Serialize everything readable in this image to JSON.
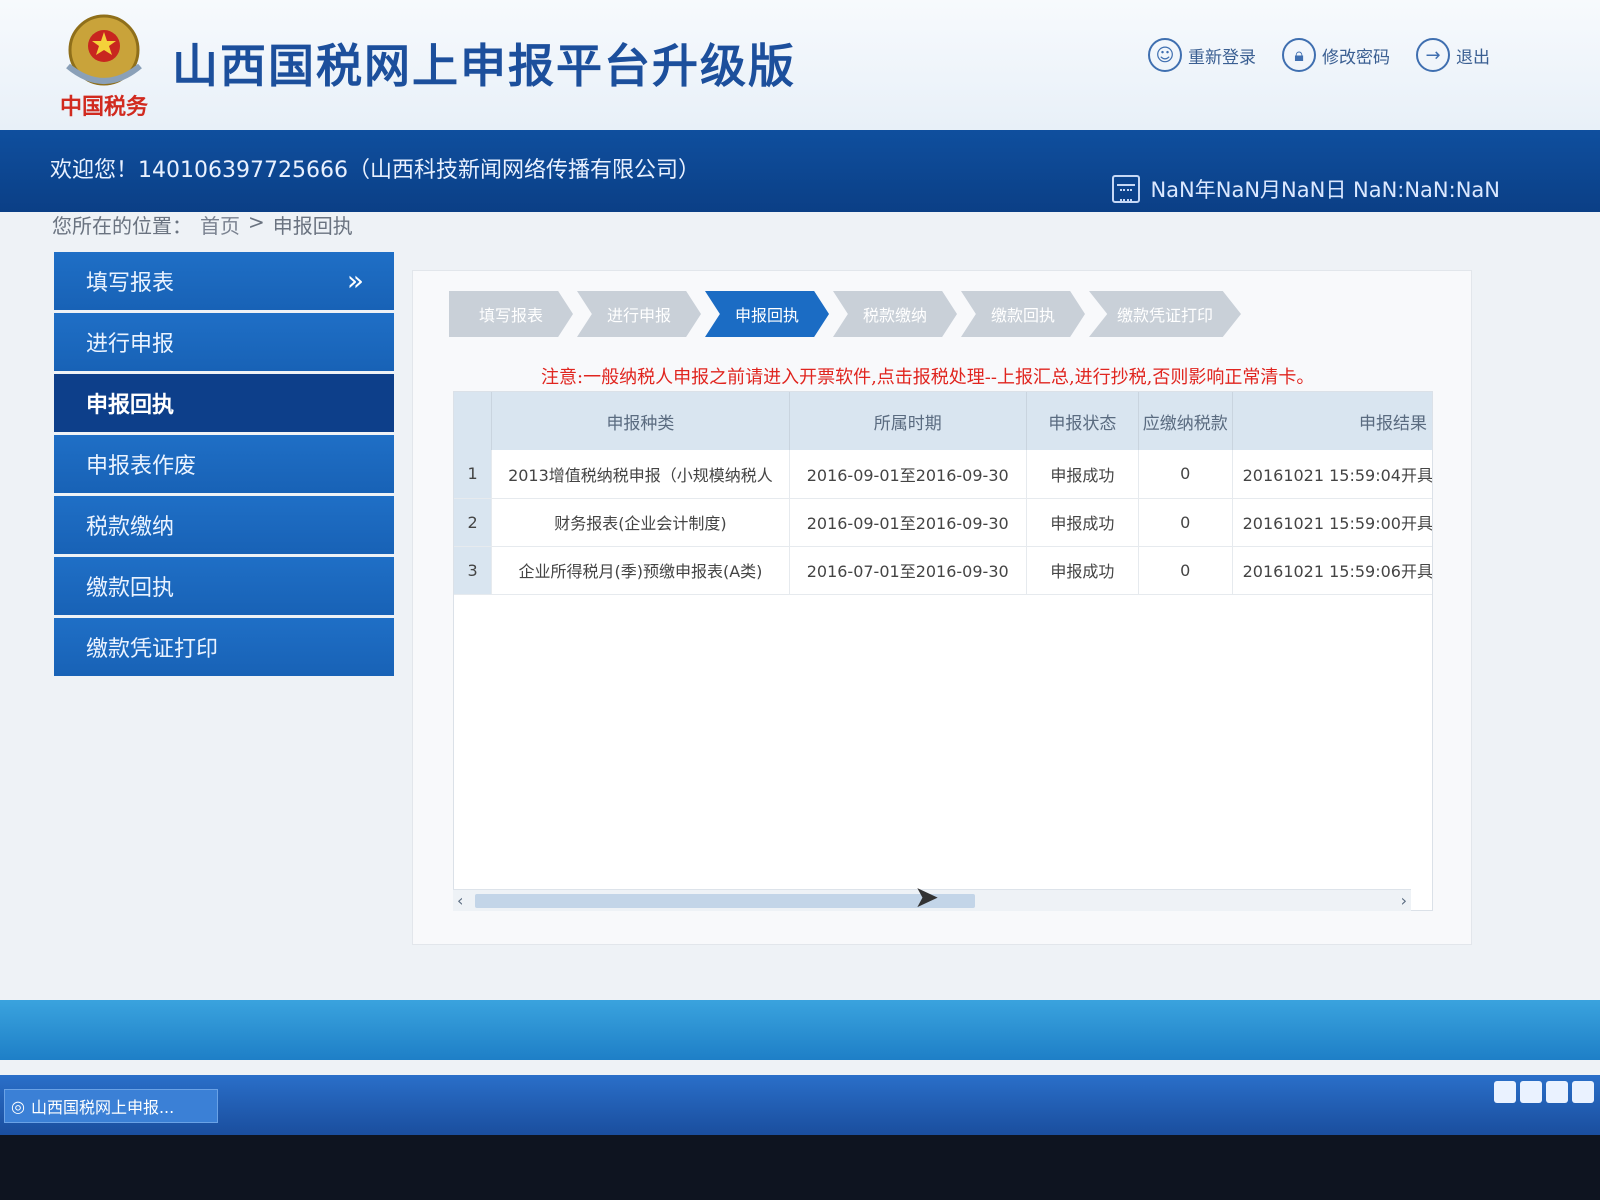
{
  "header": {
    "emblem_text": "中国税务",
    "title": "山西国税网上申报平台升级版",
    "actions": [
      {
        "label": "重新登录",
        "icon": "user-icon"
      },
      {
        "label": "修改密码",
        "icon": "lock-icon"
      },
      {
        "label": "退出",
        "icon": "logout-icon"
      }
    ]
  },
  "welcome": {
    "text": "欢迎您！140106397725666（山西科技新闻网络传播有限公司）",
    "datetime": "NaN年NaN月NaN日 NaN:NaN:NaN"
  },
  "breadcrumb": {
    "prefix": "您所在的位置：",
    "home": "首页",
    "separator": ">",
    "current": "申报回执"
  },
  "sidebar": {
    "items": [
      {
        "label": "填写报表"
      },
      {
        "label": "进行申报"
      },
      {
        "label": "申报回执",
        "active": true
      },
      {
        "label": "申报表作废"
      },
      {
        "label": "税款缴纳"
      },
      {
        "label": "缴款回执"
      },
      {
        "label": "缴款凭证打印"
      }
    ]
  },
  "steps": [
    {
      "label": "填写报表"
    },
    {
      "label": "进行申报"
    },
    {
      "label": "申报回执",
      "active": true
    },
    {
      "label": "税款缴纳"
    },
    {
      "label": "缴款回执"
    },
    {
      "label": "缴款凭证打印"
    }
  ],
  "notice": "注意:一般纳税人申报之前请进入开票软件,点击报税处理--上报汇总,进行抄税,否则影响正常清卡。",
  "table": {
    "headers": [
      "",
      "申报种类",
      "所属时期",
      "申报状态",
      "应缴纳税款",
      "申报结果"
    ],
    "rows": [
      {
        "no": "1",
        "type": "2013增值税纳税申报（小规模纳税人",
        "period": "2016-09-01至2016-09-30",
        "status": "申报成功",
        "tax": "0",
        "result": "20161021 15:59:04开具"
      },
      {
        "no": "2",
        "type": "财务报表(企业会计制度)",
        "period": "2016-09-01至2016-09-30",
        "status": "申报成功",
        "tax": "0",
        "result": "20161021 15:59:00开具"
      },
      {
        "no": "3",
        "type": "企业所得税月(季)预缴申报表(A类)",
        "period": "2016-07-01至2016-09-30",
        "status": "申报成功",
        "tax": "0",
        "result": "20161021 15:59:06开具"
      }
    ]
  },
  "taskbar": {
    "task_label": "山西国税网上申报..."
  }
}
